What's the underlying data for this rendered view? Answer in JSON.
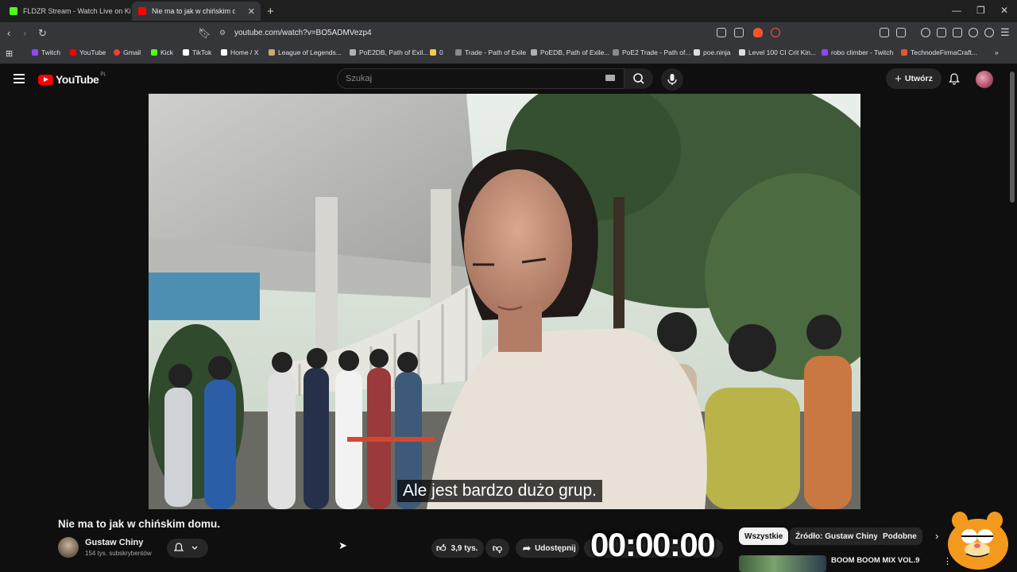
{
  "browser": {
    "tabs": [
      {
        "title": "FLDZR Stream - Watch Live on Kick",
        "favicon_color": "#53fc18",
        "active": false
      },
      {
        "title": "Nie ma to jak w chińskim dom",
        "favicon_color": "#ff0000",
        "active": true
      }
    ],
    "url": "youtube.com/watch?v=BO5ADMVezp4",
    "bookmarks": [
      {
        "label": "Twitch",
        "color": "#9146ff"
      },
      {
        "label": "YouTube",
        "color": "#ff0000"
      },
      {
        "label": "Gmail",
        "color": "#ea4335"
      },
      {
        "label": "Kick",
        "color": "#53fc18"
      },
      {
        "label": "TikTok",
        "color": "#ffffff"
      },
      {
        "label": "Home / X",
        "color": "#ffffff"
      },
      {
        "label": "League of Legends...",
        "color": "#c8aa6e"
      },
      {
        "label": "PoE2DB, Path of Exil...",
        "color": "#b0b0b0"
      },
      {
        "label": "0",
        "color": "#f2c94c"
      },
      {
        "label": "Trade - Path of Exile",
        "color": "#8a8a8a"
      },
      {
        "label": "PoEDB, Path of Exile...",
        "color": "#b0b0b0"
      },
      {
        "label": "PoE2 Trade - Path of...",
        "color": "#8a8a8a"
      },
      {
        "label": "poe.ninja",
        "color": "#dddddd"
      },
      {
        "label": "Level 100 CI Crit Kin...",
        "color": "#dddddd"
      },
      {
        "label": "robo climber - Twitch",
        "color": "#9146ff"
      },
      {
        "label": "TechnodeFirmaCraft...",
        "color": "#e4572e"
      }
    ]
  },
  "youtube": {
    "logo_text": "YouTube",
    "region": "PL",
    "search_placeholder": "Szukaj",
    "create_label": "Utwórz"
  },
  "video": {
    "subtitle": "Ale jest bardzo dużo grup.",
    "title": "Nie ma to jak w chińskim domu.",
    "channel": "Gustaw Chiny",
    "subscribers": "154 tys. subskrybentów",
    "likes": "3,9 tys.",
    "share_label": "Udostępnij",
    "timer_overlay": "00:00:00"
  },
  "recommendations": {
    "chips": [
      "Wszystkie",
      "Źródło: Gustaw Chiny",
      "Podobne"
    ],
    "first_title": "BOOM BOOM MIX VOL.9"
  },
  "colors": {
    "accent": "#ff0000",
    "background": "#0f0f0f"
  }
}
